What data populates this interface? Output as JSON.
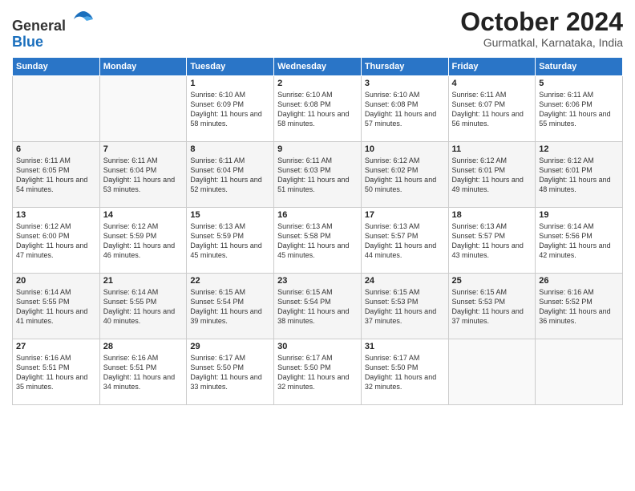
{
  "logo": {
    "general": "General",
    "blue": "Blue"
  },
  "header": {
    "month": "October 2024",
    "location": "Gurmatkal, Karnataka, India"
  },
  "weekdays": [
    "Sunday",
    "Monday",
    "Tuesday",
    "Wednesday",
    "Thursday",
    "Friday",
    "Saturday"
  ],
  "weeks": [
    [
      {
        "day": "",
        "info": ""
      },
      {
        "day": "",
        "info": ""
      },
      {
        "day": "1",
        "info": "Sunrise: 6:10 AM\nSunset: 6:09 PM\nDaylight: 11 hours and 58 minutes."
      },
      {
        "day": "2",
        "info": "Sunrise: 6:10 AM\nSunset: 6:08 PM\nDaylight: 11 hours and 58 minutes."
      },
      {
        "day": "3",
        "info": "Sunrise: 6:10 AM\nSunset: 6:08 PM\nDaylight: 11 hours and 57 minutes."
      },
      {
        "day": "4",
        "info": "Sunrise: 6:11 AM\nSunset: 6:07 PM\nDaylight: 11 hours and 56 minutes."
      },
      {
        "day": "5",
        "info": "Sunrise: 6:11 AM\nSunset: 6:06 PM\nDaylight: 11 hours and 55 minutes."
      }
    ],
    [
      {
        "day": "6",
        "info": "Sunrise: 6:11 AM\nSunset: 6:05 PM\nDaylight: 11 hours and 54 minutes."
      },
      {
        "day": "7",
        "info": "Sunrise: 6:11 AM\nSunset: 6:04 PM\nDaylight: 11 hours and 53 minutes."
      },
      {
        "day": "8",
        "info": "Sunrise: 6:11 AM\nSunset: 6:04 PM\nDaylight: 11 hours and 52 minutes."
      },
      {
        "day": "9",
        "info": "Sunrise: 6:11 AM\nSunset: 6:03 PM\nDaylight: 11 hours and 51 minutes."
      },
      {
        "day": "10",
        "info": "Sunrise: 6:12 AM\nSunset: 6:02 PM\nDaylight: 11 hours and 50 minutes."
      },
      {
        "day": "11",
        "info": "Sunrise: 6:12 AM\nSunset: 6:01 PM\nDaylight: 11 hours and 49 minutes."
      },
      {
        "day": "12",
        "info": "Sunrise: 6:12 AM\nSunset: 6:01 PM\nDaylight: 11 hours and 48 minutes."
      }
    ],
    [
      {
        "day": "13",
        "info": "Sunrise: 6:12 AM\nSunset: 6:00 PM\nDaylight: 11 hours and 47 minutes."
      },
      {
        "day": "14",
        "info": "Sunrise: 6:12 AM\nSunset: 5:59 PM\nDaylight: 11 hours and 46 minutes."
      },
      {
        "day": "15",
        "info": "Sunrise: 6:13 AM\nSunset: 5:59 PM\nDaylight: 11 hours and 45 minutes."
      },
      {
        "day": "16",
        "info": "Sunrise: 6:13 AM\nSunset: 5:58 PM\nDaylight: 11 hours and 45 minutes."
      },
      {
        "day": "17",
        "info": "Sunrise: 6:13 AM\nSunset: 5:57 PM\nDaylight: 11 hours and 44 minutes."
      },
      {
        "day": "18",
        "info": "Sunrise: 6:13 AM\nSunset: 5:57 PM\nDaylight: 11 hours and 43 minutes."
      },
      {
        "day": "19",
        "info": "Sunrise: 6:14 AM\nSunset: 5:56 PM\nDaylight: 11 hours and 42 minutes."
      }
    ],
    [
      {
        "day": "20",
        "info": "Sunrise: 6:14 AM\nSunset: 5:55 PM\nDaylight: 11 hours and 41 minutes."
      },
      {
        "day": "21",
        "info": "Sunrise: 6:14 AM\nSunset: 5:55 PM\nDaylight: 11 hours and 40 minutes."
      },
      {
        "day": "22",
        "info": "Sunrise: 6:15 AM\nSunset: 5:54 PM\nDaylight: 11 hours and 39 minutes."
      },
      {
        "day": "23",
        "info": "Sunrise: 6:15 AM\nSunset: 5:54 PM\nDaylight: 11 hours and 38 minutes."
      },
      {
        "day": "24",
        "info": "Sunrise: 6:15 AM\nSunset: 5:53 PM\nDaylight: 11 hours and 37 minutes."
      },
      {
        "day": "25",
        "info": "Sunrise: 6:15 AM\nSunset: 5:53 PM\nDaylight: 11 hours and 37 minutes."
      },
      {
        "day": "26",
        "info": "Sunrise: 6:16 AM\nSunset: 5:52 PM\nDaylight: 11 hours and 36 minutes."
      }
    ],
    [
      {
        "day": "27",
        "info": "Sunrise: 6:16 AM\nSunset: 5:51 PM\nDaylight: 11 hours and 35 minutes."
      },
      {
        "day": "28",
        "info": "Sunrise: 6:16 AM\nSunset: 5:51 PM\nDaylight: 11 hours and 34 minutes."
      },
      {
        "day": "29",
        "info": "Sunrise: 6:17 AM\nSunset: 5:50 PM\nDaylight: 11 hours and 33 minutes."
      },
      {
        "day": "30",
        "info": "Sunrise: 6:17 AM\nSunset: 5:50 PM\nDaylight: 11 hours and 32 minutes."
      },
      {
        "day": "31",
        "info": "Sunrise: 6:17 AM\nSunset: 5:50 PM\nDaylight: 11 hours and 32 minutes."
      },
      {
        "day": "",
        "info": ""
      },
      {
        "day": "",
        "info": ""
      }
    ]
  ]
}
